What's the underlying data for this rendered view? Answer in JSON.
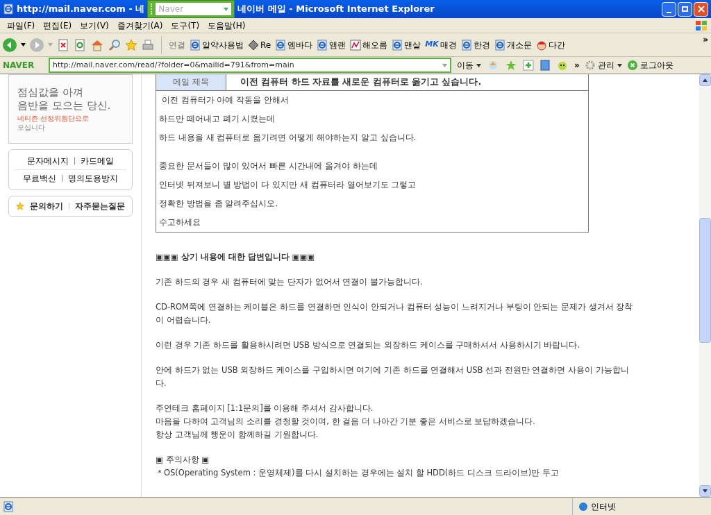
{
  "window": {
    "title_start": "http://mail.naver.com - 네",
    "title_end": "네이버 메일 - Microsoft Internet Explorer"
  },
  "search_overlay": {
    "value": "Naver"
  },
  "menu": [
    "파일(F)",
    "편집(E)",
    "보기(V)",
    "즐겨찾기(A)",
    "도구(T)",
    "도움말(H)"
  ],
  "links_label": "연결",
  "links": [
    {
      "kind": "ie",
      "label": "알약사용법"
    },
    {
      "kind": "diamond",
      "label": "Re"
    },
    {
      "kind": "ie",
      "label": "엠바다"
    },
    {
      "kind": "ie",
      "label": "앰랜"
    },
    {
      "kind": "chart",
      "label": "해오름"
    },
    {
      "kind": "ie",
      "label": "맨살"
    },
    {
      "kind": "mk",
      "label": "매경",
      "badge": "MK"
    },
    {
      "kind": "ie",
      "label": "한경"
    },
    {
      "kind": "ie",
      "label": "개소문"
    },
    {
      "kind": "kid",
      "label": "다간"
    }
  ],
  "overflow": "»",
  "naver_bar": {
    "logo": "NAVER",
    "url": "http://mail.naver.com/read/?folder=0&mailid=791&from=main",
    "go": "이동",
    "more": "»",
    "manage": "관리",
    "logout": "로그아웃"
  },
  "sidebar": {
    "banner": [
      "점심값을 아껴",
      "음반을 모으는 당신.",
      "네티즌 선정위원단으로",
      "모십니다"
    ],
    "services": [
      [
        "문자메시지",
        "카드메일"
      ],
      [
        "무료백신",
        "명의도용방지"
      ]
    ],
    "help": [
      "문의하기",
      "자주묻는질문"
    ]
  },
  "mail": {
    "subject_label": "메일 제목",
    "subject": "이전 컴퓨터 하드 자료를 새로운 컴퓨터로 옮기고 싶습니다.",
    "body": [
      [
        " 이전 컴퓨터가 아예 작동을 안해서",
        "하드만 떼어내고 폐기 시켰는데",
        "하드 내용을 새 컴퓨터로 옮기려면 어떻게 해야하는지 알고 싶습니다."
      ],
      [
        "중요한 문서들이 많이 있어서 빠른 시간내에 옮겨야 하는데",
        "인터넷 뒤져보니 별 방법이 다 있지만 새 컴퓨터라 열어보기도 그렇고",
        "정확한 방법을 좀 알려주십시오.",
        "수고하세요"
      ]
    ]
  },
  "reply": [
    {
      "kind": "heading",
      "lines": [
        "▣▣▣ 상기 내용에 대한 답변입니다 ▣▣▣"
      ]
    },
    {
      "kind": "text",
      "lines": [
        "기존 하드의 경우 새 컴퓨터에 맞는 단자가 없어서 연결이 불가능합니다."
      ]
    },
    {
      "kind": "text",
      "lines": [
        "CD-ROM쪽에 연결하는 케이블은 하드를 연결하면 인식이 안되거나 컴퓨터 성능이 느려지거나 부팅이 안되는 문제가 생겨서 장착",
        "이 어렵습니다."
      ]
    },
    {
      "kind": "text",
      "lines": [
        "이런 경우 기존 하드를 활용하시려면 USB 방식으로 연결되는 외장하드 케이스를 구매하셔서 사용하시기 바랍니다."
      ]
    },
    {
      "kind": "text",
      "lines": [
        "안에 하드가 없는 USB 외장하드 케이스를 구입하시면 여기에 기존 하드를 연결해서 USB 선과 전원만 연결하면 사용이 가능합니",
        "다."
      ]
    },
    {
      "kind": "text",
      "lines": [
        "주연테크 홈페이지 [1:1문의]를 이용해 주셔서 감사합니다.",
        "마음을 다하여 고객님의 소리를 경청할 것이며, 한 걸음 더 나아간 기분 좋은 서비스로 보답하겠습니다.",
        "항상 고객님께 행운이 함께하길 기원합니다."
      ]
    },
    {
      "kind": "text",
      "lines": [
        "▣ 주의사항 ▣",
        "＊OS(Operating System : 운영체제)를 다시 설치하는 경우에는 설치 할 HDD(하드 디스크 드라이브)만 두고"
      ]
    }
  ],
  "status": {
    "zone": "인터넷"
  }
}
